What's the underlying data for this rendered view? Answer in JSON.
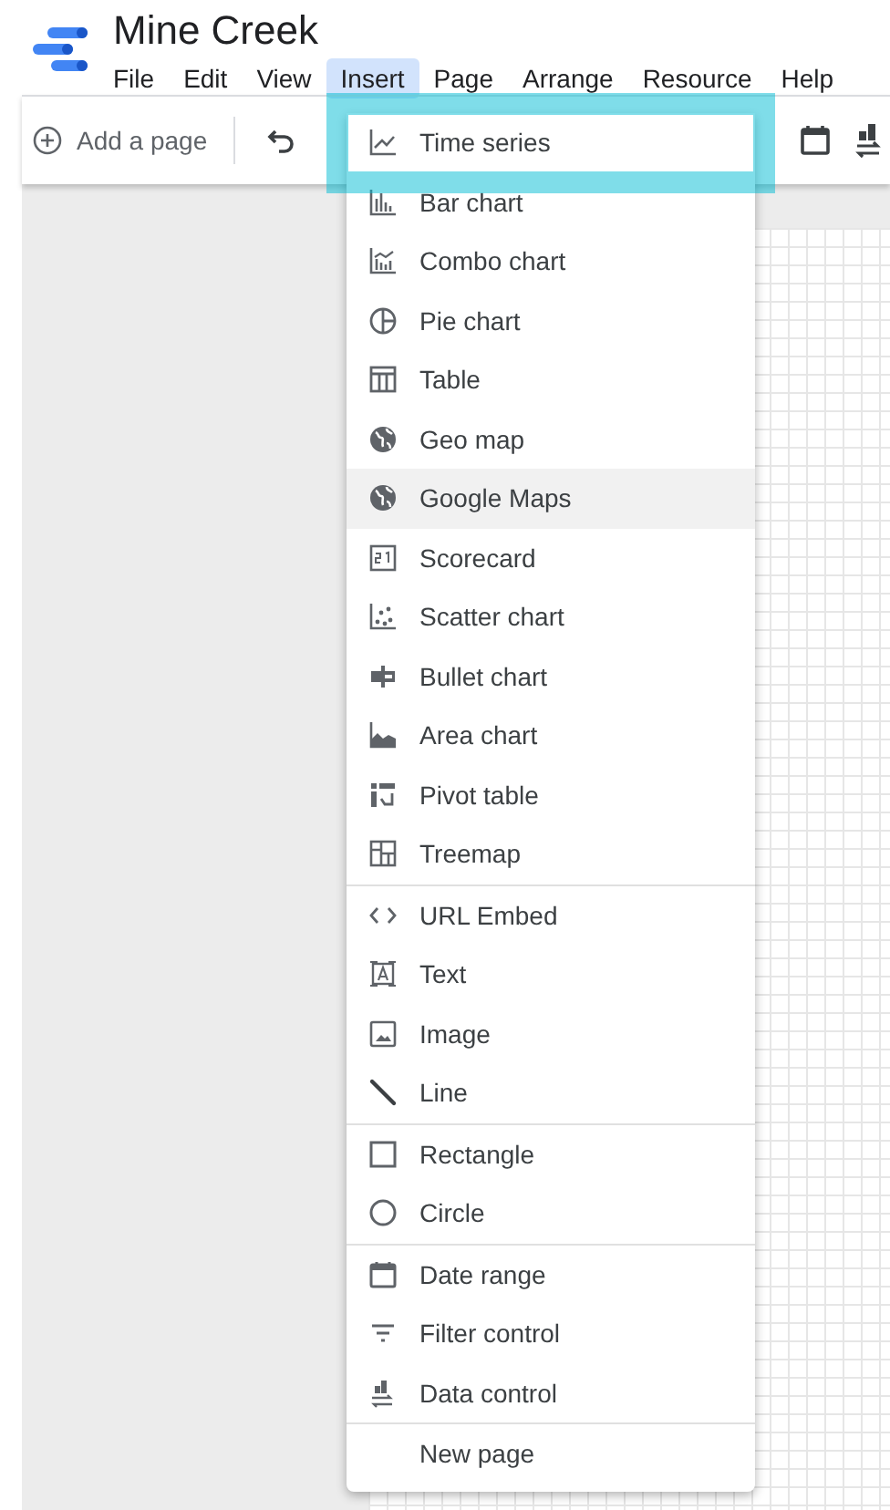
{
  "app": {
    "title": "Mine Creek"
  },
  "menu_bar": [
    {
      "label": "File",
      "selected": false
    },
    {
      "label": "Edit",
      "selected": false
    },
    {
      "label": "View",
      "selected": false
    },
    {
      "label": "Insert",
      "selected": true
    },
    {
      "label": "Page",
      "selected": false
    },
    {
      "label": "Arrange",
      "selected": false
    },
    {
      "label": "Resource",
      "selected": false
    },
    {
      "label": "Help",
      "selected": false
    }
  ],
  "toolbar": {
    "add_page": "Add a page"
  },
  "insert_menu": [
    [
      {
        "label": "Time series",
        "kind": "timeseries",
        "selected": true,
        "hovered": false
      },
      {
        "label": "Bar chart",
        "kind": "bar",
        "selected": false,
        "hovered": false
      },
      {
        "label": "Combo chart",
        "kind": "combo",
        "selected": false,
        "hovered": false
      },
      {
        "label": "Pie chart",
        "kind": "pie",
        "selected": false,
        "hovered": false
      },
      {
        "label": "Table",
        "kind": "table",
        "selected": false,
        "hovered": false
      },
      {
        "label": "Geo map",
        "kind": "globe",
        "selected": false,
        "hovered": false
      },
      {
        "label": "Google Maps",
        "kind": "globe",
        "selected": false,
        "hovered": true
      },
      {
        "label": "Scorecard",
        "kind": "scorecard",
        "selected": false,
        "hovered": false
      },
      {
        "label": "Scatter chart",
        "kind": "scatter",
        "selected": false,
        "hovered": false
      },
      {
        "label": "Bullet chart",
        "kind": "bullet",
        "selected": false,
        "hovered": false
      },
      {
        "label": "Area chart",
        "kind": "area",
        "selected": false,
        "hovered": false
      },
      {
        "label": "Pivot table",
        "kind": "pivot",
        "selected": false,
        "hovered": false
      },
      {
        "label": "Treemap",
        "kind": "treemap",
        "selected": false,
        "hovered": false
      }
    ],
    [
      {
        "label": "URL Embed",
        "kind": "embed",
        "selected": false,
        "hovered": false
      },
      {
        "label": "Text",
        "kind": "text",
        "selected": false,
        "hovered": false
      },
      {
        "label": "Image",
        "kind": "image",
        "selected": false,
        "hovered": false
      },
      {
        "label": "Line",
        "kind": "line",
        "selected": false,
        "hovered": false
      }
    ],
    [
      {
        "label": "Rectangle",
        "kind": "rectangle",
        "selected": false,
        "hovered": false
      },
      {
        "label": "Circle",
        "kind": "circle",
        "selected": false,
        "hovered": false
      }
    ],
    [
      {
        "label": "Date range",
        "kind": "calendar",
        "selected": false,
        "hovered": false
      },
      {
        "label": "Filter control",
        "kind": "filter",
        "selected": false,
        "hovered": false
      },
      {
        "label": "Data control",
        "kind": "datacontrol",
        "selected": false,
        "hovered": false
      }
    ],
    [
      {
        "label": "New page",
        "kind": "none",
        "selected": false,
        "hovered": false
      }
    ]
  ]
}
